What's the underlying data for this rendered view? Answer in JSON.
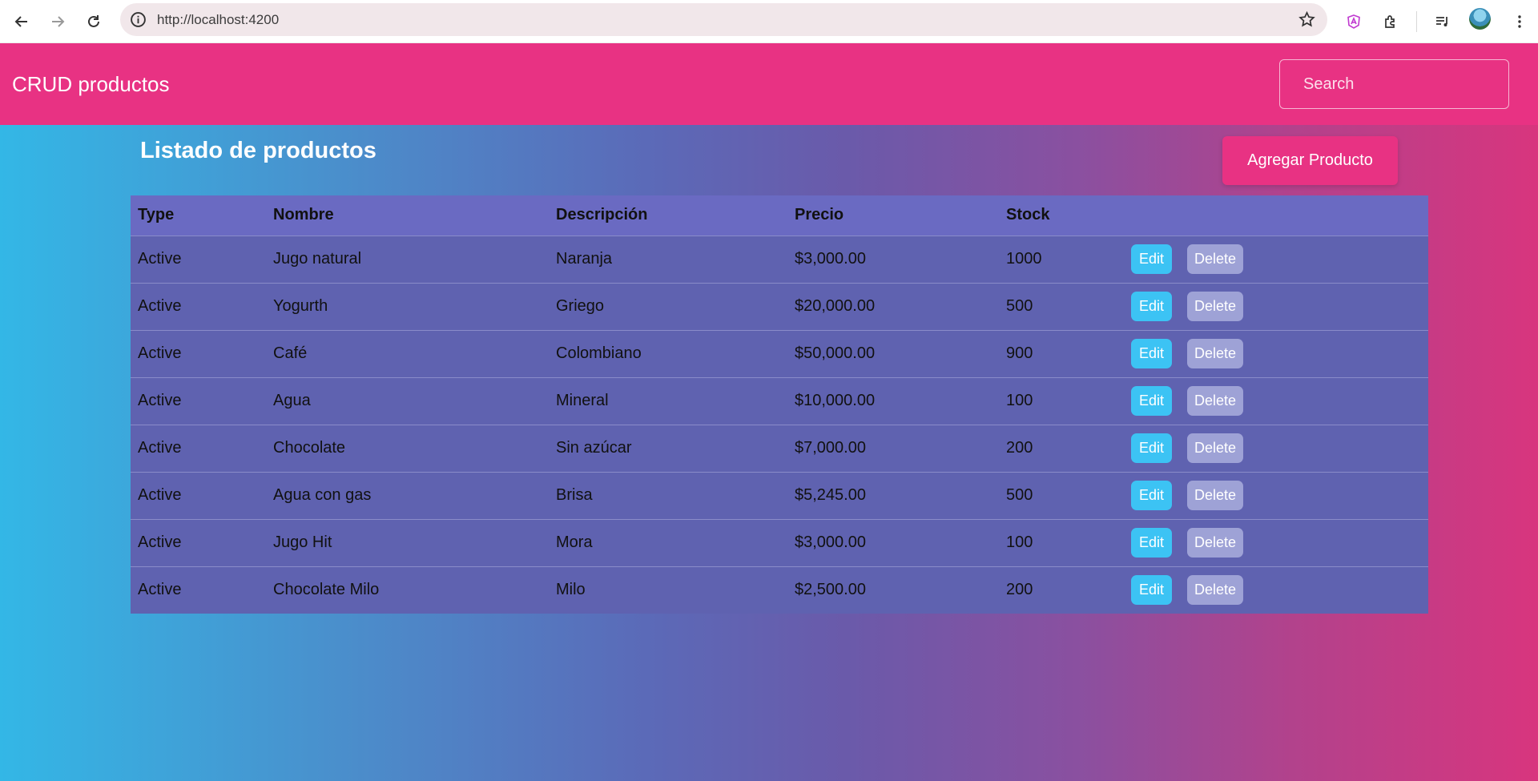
{
  "browser": {
    "url": "http://localhost:4200"
  },
  "header": {
    "brand": "CRUD productos",
    "search_placeholder": "Search"
  },
  "main": {
    "title": "Listado de productos",
    "add_button": "Agregar Producto",
    "columns": [
      "Type",
      "Nombre",
      "Descripción",
      "Precio",
      "Stock",
      ""
    ],
    "edit_label": "Edit",
    "delete_label": "Delete",
    "rows": [
      {
        "type": "Active",
        "nombre": "Jugo natural",
        "descripcion": "Naranja",
        "precio": "$3,000.00",
        "stock": "1000"
      },
      {
        "type": "Active",
        "nombre": "Yogurth",
        "descripcion": "Griego",
        "precio": "$20,000.00",
        "stock": "500"
      },
      {
        "type": "Active",
        "nombre": "Café",
        "descripcion": "Colombiano",
        "precio": "$50,000.00",
        "stock": "900"
      },
      {
        "type": "Active",
        "nombre": "Agua",
        "descripcion": "Mineral",
        "precio": "$10,000.00",
        "stock": "100"
      },
      {
        "type": "Active",
        "nombre": "Chocolate",
        "descripcion": "Sin azúcar",
        "precio": "$7,000.00",
        "stock": "200"
      },
      {
        "type": "Active",
        "nombre": "Agua con gas",
        "descripcion": "Brisa",
        "precio": "$5,245.00",
        "stock": "500"
      },
      {
        "type": "Active",
        "nombre": "Jugo Hit",
        "descripcion": "Mora",
        "precio": "$3,000.00",
        "stock": "100"
      },
      {
        "type": "Active",
        "nombre": "Chocolate Milo",
        "descripcion": "Milo",
        "precio": "$2,500.00",
        "stock": "200"
      }
    ]
  },
  "colors": {
    "brand_pink": "#e83283",
    "table_header": "#6a6ac2",
    "table_row": "#5f62b0",
    "edit_button": "#3cc3f4",
    "delete_button": "#9ea2d6"
  }
}
